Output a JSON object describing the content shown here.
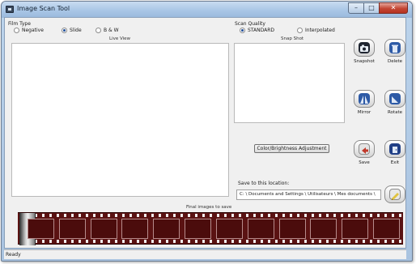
{
  "window": {
    "title": "Image Scan Tool",
    "controls": {
      "minimize": "–",
      "maximize": "□",
      "close": "✕"
    }
  },
  "film_type": {
    "label": "Film Type",
    "options": [
      "Negative",
      "Slide",
      "B & W"
    ],
    "selected": "Slide"
  },
  "scan_quality": {
    "label": "Scan Quality",
    "options": [
      "STANDARD",
      "Interpolated"
    ],
    "selected": "STANDARD"
  },
  "panels": {
    "live_view": "Live View",
    "snap_shot": "Snap Shot"
  },
  "buttons": {
    "snapshot": "Snapshot",
    "delete": "Delete",
    "mirror": "Mirror",
    "rotate": "Rotate",
    "save": "Save",
    "exit": "Exit",
    "color_brightness": "Color/Brightness Adjustment"
  },
  "save_location": {
    "label": "Save to this location:",
    "path": "C: \\ Documents and Settings \\ Utilisateurs \\ Mes documents \\"
  },
  "filmstrip": {
    "label": "Final images to save",
    "frame_count": 12
  },
  "status": "Ready",
  "colors": {
    "accent": "#1f4f9c",
    "film": "#5a1212",
    "close_button": "#c34532"
  },
  "icons": {
    "snapshot": "camera-icon",
    "delete": "trash-icon",
    "mirror": "mirror-icon",
    "rotate": "rotate-icon",
    "save": "save-icon",
    "exit": "exit-icon",
    "browse": "folder-icon"
  }
}
